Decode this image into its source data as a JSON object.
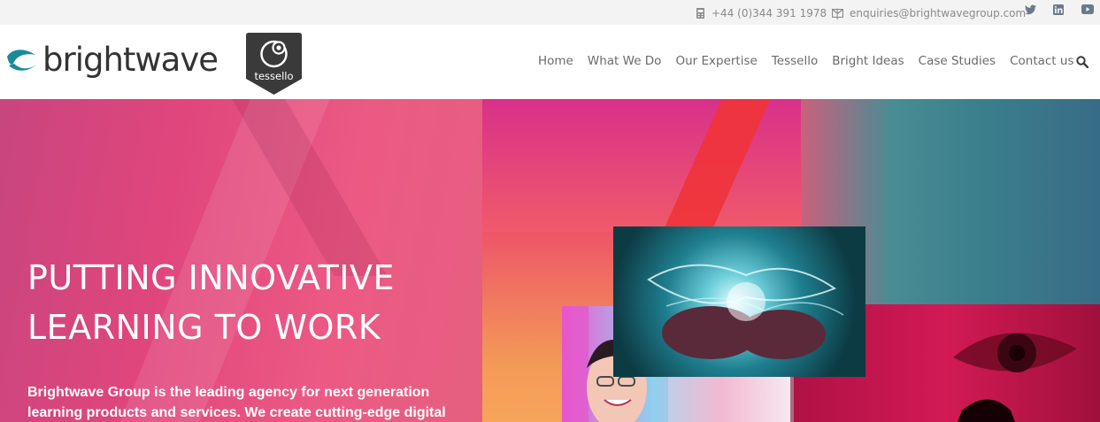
{
  "topbar": {
    "phone": "+44 (0)344 391 1978",
    "separator": "|",
    "email": "enquiries@brightwavegroup.com",
    "icons": [
      "phone-icon",
      "mail-icon",
      "twitter-icon",
      "linkedin-icon",
      "youtube-icon"
    ]
  },
  "brand": {
    "name": "brightwave",
    "badge_text": "tessello",
    "colors": {
      "wave": "#1a8a9a",
      "badge": "#3a3a3a"
    }
  },
  "nav": {
    "items": [
      "Home",
      "What We Do",
      "Our Expertise",
      "Tessello",
      "Bright Ideas",
      "Case Studies",
      "Contact us"
    ],
    "search_icon": "search-icon"
  },
  "hero": {
    "headline_line1": "PUTTING INNOVATIVE",
    "headline_line2": "LEARNING TO WORK",
    "intro_line1": "Brightwave Group is the leading agency for next generation",
    "intro_line2": "learning products and services. We create cutting-edge digital",
    "colors": {
      "primary": "#e0467c"
    }
  }
}
